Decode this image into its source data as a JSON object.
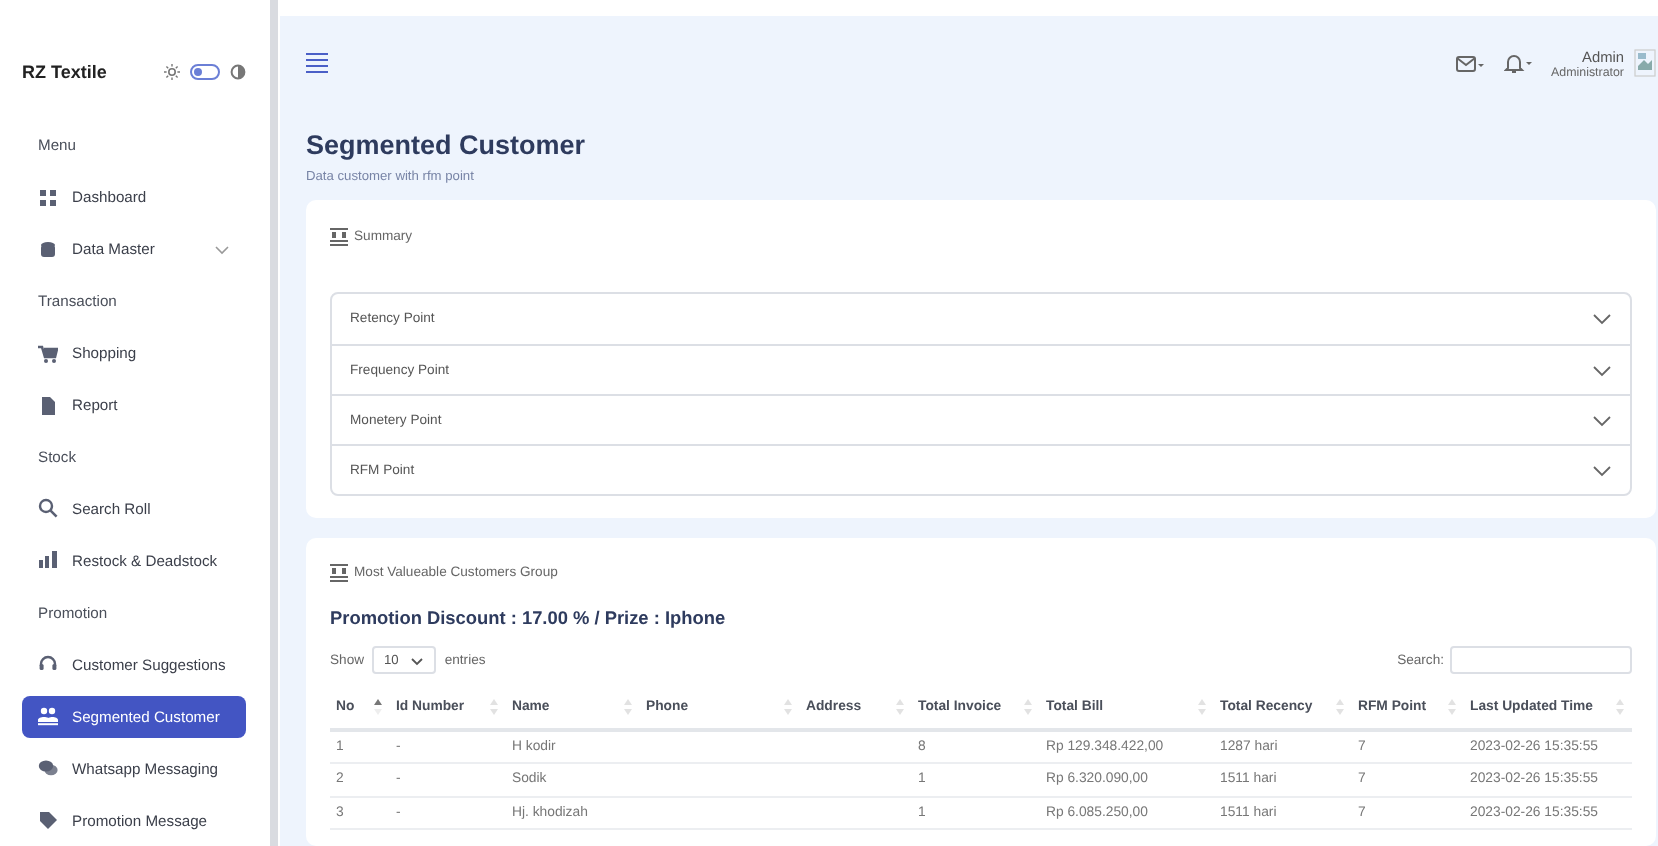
{
  "sidebar": {
    "brand": "RZ Textile",
    "theme_toggle": {
      "on": false
    },
    "sections": [
      {
        "label": "Menu",
        "items": [
          {
            "label": "Dashboard",
            "selected": false,
            "kind": "link"
          },
          {
            "label": "Data Master",
            "selected": false,
            "kind": "dropdown",
            "expanded": false
          }
        ]
      },
      {
        "label": "Transaction",
        "items": [
          {
            "label": "Shopping",
            "selected": false,
            "kind": "link"
          },
          {
            "label": "Report",
            "selected": false,
            "kind": "link"
          }
        ]
      },
      {
        "label": "Stock",
        "items": [
          {
            "label": "Search Roll",
            "selected": false,
            "kind": "link"
          },
          {
            "label": "Restock & Deadstock",
            "selected": false,
            "kind": "link"
          }
        ]
      },
      {
        "label": "Promotion",
        "items": [
          {
            "label": "Customer Suggestions",
            "selected": false,
            "kind": "link"
          },
          {
            "label": "Segmented Customer",
            "selected": true,
            "kind": "link"
          },
          {
            "label": "Whatsapp Messaging",
            "selected": false,
            "kind": "link"
          },
          {
            "label": "Promotion Message",
            "selected": false,
            "kind": "link"
          }
        ]
      }
    ]
  },
  "header": {
    "user_name": "Admin",
    "user_role": "Administrator"
  },
  "page": {
    "title": "Segmented Customer",
    "subtitle": "Data customer with rfm point"
  },
  "summary": {
    "title": "Summary",
    "items": [
      {
        "label": "Retency Point",
        "expanded": false
      },
      {
        "label": "Frequency Point",
        "expanded": false
      },
      {
        "label": "Monetery Point",
        "expanded": false
      },
      {
        "label": "RFM Point",
        "expanded": false
      }
    ]
  },
  "group": {
    "title": "Most Valueable Customers Group",
    "promotion": "Promotion Discount : 17.00 % / Prize : Iphone",
    "show_label": "Show",
    "page_size": "10",
    "entries_label": "entries",
    "search_label": "Search:",
    "table": {
      "columns": [
        {
          "label": "No",
          "sorted": true
        },
        {
          "label": "Id Number",
          "sorted": false
        },
        {
          "label": "Name",
          "sorted": false
        },
        {
          "label": "Phone",
          "sorted": false
        },
        {
          "label": "Address",
          "sorted": false
        },
        {
          "label": "Total Invoice",
          "sorted": false
        },
        {
          "label": "Total Bill",
          "sorted": false
        },
        {
          "label": "Total Recency",
          "sorted": false
        },
        {
          "label": "RFM Point",
          "sorted": false
        },
        {
          "label": "Last Updated Time",
          "sorted": false
        }
      ],
      "rows": [
        [
          "1",
          "-",
          "H kodir",
          "",
          "",
          "8",
          "Rp 129.348.422,00",
          "1287 hari",
          "7",
          "2023-02-26 15:35:55"
        ],
        [
          "2",
          "-",
          "Sodik",
          "",
          "",
          "1",
          "Rp 6.320.090,00",
          "1511 hari",
          "7",
          "2023-02-26 15:35:55"
        ],
        [
          "3",
          "-",
          "Hj. khodizah",
          "",
          "",
          "1",
          "Rp 6.085.250,00",
          "1511 hari",
          "7",
          "2023-02-26 15:35:55"
        ]
      ]
    }
  }
}
